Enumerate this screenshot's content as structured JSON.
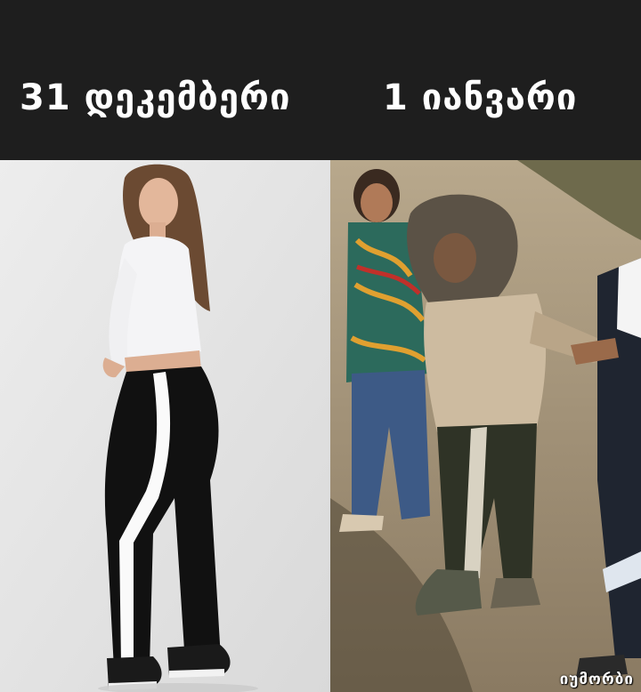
{
  "captions": {
    "left": "31 დეკემბერი",
    "right": "1 იანვარი"
  },
  "watermark": "იუმორბი",
  "colors": {
    "header_background": "#1e1e1e",
    "caption_text": "#ffffff",
    "left_backdrop": "#e6e6e6",
    "right_ground": "#c9b79c"
  }
}
